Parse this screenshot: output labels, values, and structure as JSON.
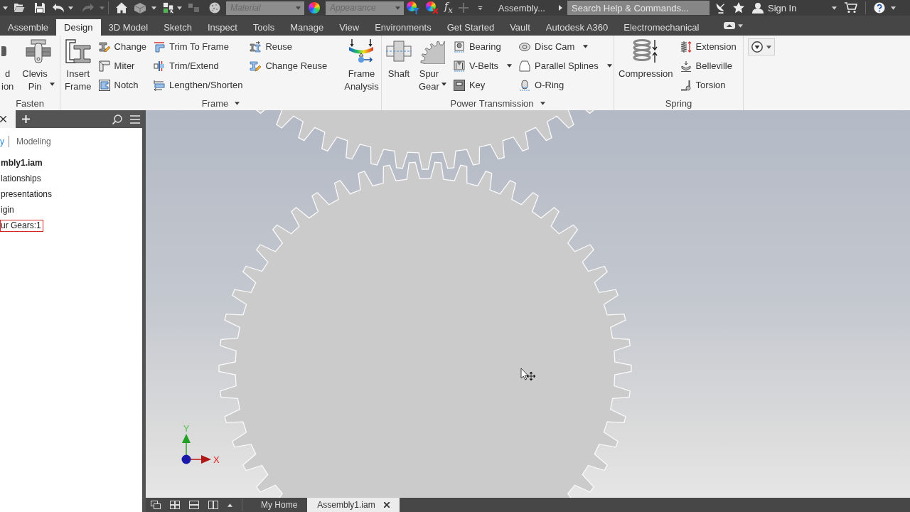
{
  "quick_access": {
    "undo": {
      "disabled": false
    },
    "redo": {
      "disabled": true
    },
    "material": {
      "value": "Material",
      "disabled": true
    },
    "appearance": {
      "value": "Appearance",
      "disabled": true
    },
    "formula": "f$_{x}$",
    "add": {
      "disabled": true
    },
    "document": "Assembly...",
    "search": {
      "placeholder": "Search Help & Commands..."
    },
    "sign_in": "Sign In"
  },
  "tabs": [
    {
      "label": "Assemble",
      "selected": false
    },
    {
      "label": "Design",
      "selected": true
    },
    {
      "label": "3D Model",
      "selected": false
    },
    {
      "label": "Sketch",
      "selected": false
    },
    {
      "label": "Inspect",
      "selected": false
    },
    {
      "label": "Tools",
      "selected": false
    },
    {
      "label": "Manage",
      "selected": false
    },
    {
      "label": "View",
      "selected": false
    },
    {
      "label": "Environments",
      "selected": false
    },
    {
      "label": "Get Started",
      "selected": false
    },
    {
      "label": "Vault",
      "selected": false
    },
    {
      "label": "Autodesk A360",
      "selected": false
    },
    {
      "label": "Electromechanical",
      "selected": false
    }
  ],
  "ribbon": [
    {
      "title": "Fasten",
      "menu": false,
      "groups": [
        {
          "kind": "large",
          "label": "d\nion",
          "dropdown": false
        },
        {
          "kind": "large",
          "label": "Clevis\nPin",
          "dropdown": true
        }
      ]
    },
    {
      "title": "Frame",
      "menu": true,
      "groups": [
        {
          "kind": "large",
          "label": "Insert\nFrame",
          "dropdown": false
        },
        {
          "kind": "column",
          "items": [
            {
              "label": "Change",
              "dropdown": false
            },
            {
              "label": "Miter",
              "dropdown": false
            },
            {
              "label": "Notch",
              "dropdown": false
            }
          ]
        },
        {
          "kind": "column",
          "items": [
            {
              "label": "Trim To Frame",
              "dropdown": false
            },
            {
              "label": "Trim/Extend",
              "dropdown": false
            },
            {
              "label": "Lengthen/Shorten",
              "dropdown": false
            }
          ]
        },
        {
          "kind": "column",
          "items": [
            {
              "label": "Reuse",
              "dropdown": false
            },
            {
              "label": "Change Reuse",
              "dropdown": false
            }
          ]
        },
        {
          "kind": "separator"
        },
        {
          "kind": "large",
          "label": "Frame\nAnalysis",
          "dropdown": false
        }
      ]
    },
    {
      "title": "Power Transmission",
      "menu": true,
      "groups": [
        {
          "kind": "large",
          "label": "Shaft",
          "dropdown": false
        },
        {
          "kind": "large",
          "label": "Spur\nGear",
          "dropdown": true
        },
        {
          "kind": "column",
          "items": [
            {
              "label": "Bearing",
              "dropdown": false
            },
            {
              "label": "V-Belts",
              "dropdown": true
            },
            {
              "label": "Key",
              "dropdown": false
            }
          ]
        },
        {
          "kind": "column",
          "items": [
            {
              "label": "Disc Cam",
              "dropdown": true
            },
            {
              "label": "Parallel Splines",
              "dropdown": true
            },
            {
              "label": "O-Ring",
              "dropdown": false
            }
          ]
        }
      ]
    },
    {
      "title": "Spring",
      "menu": false,
      "groups": [
        {
          "kind": "large",
          "label": "Compression",
          "dropdown": false
        },
        {
          "kind": "column",
          "items": [
            {
              "label": "Extension",
              "dropdown": false
            },
            {
              "label": "Belleville",
              "dropdown": false
            },
            {
              "label": "Torsion",
              "dropdown": false
            }
          ]
        }
      ]
    }
  ],
  "browser": {
    "views": [
      {
        "label": "y",
        "selected": true
      },
      {
        "label": "Modeling",
        "selected": false
      }
    ],
    "tree": [
      {
        "label": "mbly1.iam",
        "selected": false,
        "children": [
          {
            "label": "lationships",
            "selected": false
          },
          {
            "label": "presentations",
            "selected": false
          },
          {
            "label": "igin",
            "selected": false
          },
          {
            "label": "ur Gears:1",
            "selected": true
          }
        ]
      }
    ]
  },
  "viewport": {
    "triad": {
      "y_label": "Y",
      "x_label": "X"
    }
  },
  "document_tabs": [
    {
      "label": "My Home",
      "selected": false
    },
    {
      "label": "Assembly1.iam",
      "selected": true
    }
  ]
}
